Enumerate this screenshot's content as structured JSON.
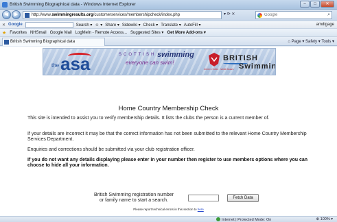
{
  "window": {
    "title": "British Swimming Biographical data - Windows Internet Explorer",
    "controls": {
      "minimize": "–",
      "maximize": "□",
      "close": "✕"
    }
  },
  "address_bar": {
    "url_prefix": "http://www.",
    "url_domain": "swimmingresults.org",
    "url_path": "/customerservices/membershipcheck/index.php",
    "search_placeholder": "Google"
  },
  "google_toolbar": {
    "logo": "Google",
    "items": [
      "Search ▾",
      "☺ ▾",
      "Share ▾",
      "Sidewiki ▾",
      "Check ▾",
      "Translate ▾",
      "AutoFill ▾"
    ],
    "account": "amdigage"
  },
  "favorites_bar": {
    "label": "Favorites",
    "items": [
      "NHSmail",
      "Google Mail",
      "LogMeIn - Remote Access...",
      "Suggested Sites ▾",
      "Get More Add-ons ▾"
    ]
  },
  "tab": {
    "title": "British Swimming Biographical data"
  },
  "command_bar": {
    "items": [
      "Page ▾",
      "Safety ▾",
      "Tools ▾"
    ]
  },
  "banner": {
    "asa_the": "the",
    "asa_logo": "asa",
    "scottish": "SCOTTISH",
    "swimming": "swimming",
    "tagline": "everyone can swim!",
    "welsh_text": "NOFIO CYMRU · SWIM WALES",
    "british": "BRITISH",
    "swimming_word": "Swimming"
  },
  "page": {
    "title": "Home Country Membership Check",
    "paragraph_1": "This site is intended to assist you to verify membership details. It lists the clubs the person is a current member of.",
    "paragraph_2": "If your details are incorrect it may be that the correct information has not been submitted to the relevant Home Country Membership Services Department.",
    "paragraph_3": "Enquiries and corrections should be submitted via your club registration officer.",
    "paragraph_4": "If you do not want any details displaying please enter in your number then register to use members options where you can choose to hide all your information.",
    "form_label_line1": "British Swimming registration number",
    "form_label_line2": "or family name to start a search.",
    "input_value": "",
    "fetch_button": "Fetch Data",
    "report_text": "Please report technical errors in this section to",
    "report_link": "here"
  },
  "status_bar": {
    "zone": "Internet | Protected Mode: On",
    "zoom": "⊕ 100% ▾"
  }
}
